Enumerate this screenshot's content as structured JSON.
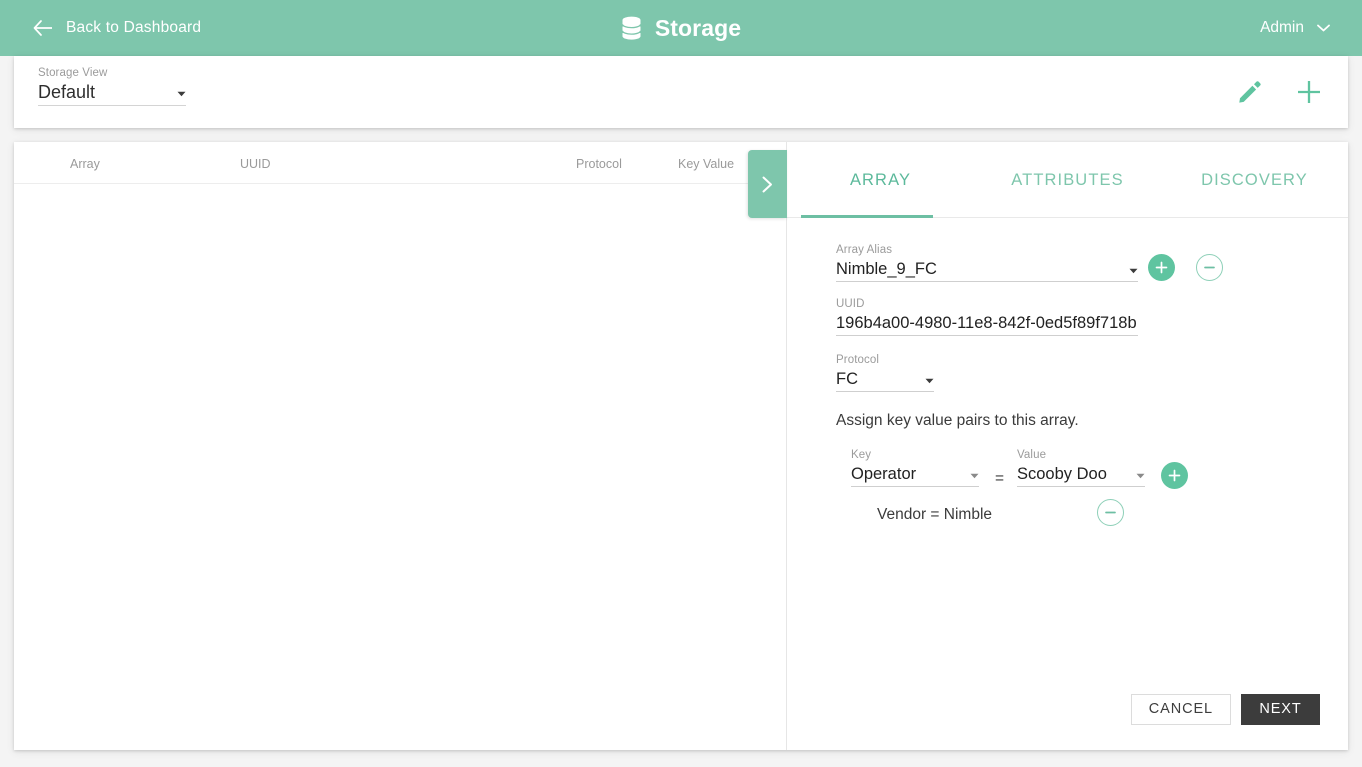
{
  "header": {
    "back_label": "Back to Dashboard",
    "back_icon": "arrow-left-icon",
    "title": "Storage",
    "title_icon": "database-icon",
    "user_label": "Admin",
    "user_caret_icon": "chevron-down-icon",
    "background_color": "#7ec6ac"
  },
  "toolbar": {
    "storage_view_label": "Storage View",
    "storage_view_value": "Default",
    "edit_icon": "pencil-icon",
    "add_icon": "plus-icon",
    "accent_color": "#5fc4a0"
  },
  "table": {
    "columns": [
      "Array",
      "UUID",
      "Protocol",
      "Key Value"
    ],
    "rows": []
  },
  "collapse_tab": {
    "icon": "chevron-right-icon"
  },
  "detail": {
    "tabs": [
      {
        "label": "ARRAY",
        "active": true
      },
      {
        "label": "ATTRIBUTES",
        "active": false
      },
      {
        "label": "DISCOVERY",
        "active": false
      }
    ],
    "fields": {
      "array_alias_label": "Array Alias",
      "array_alias_value": "Nimble_9_FC",
      "uuid_label": "UUID",
      "uuid_value": "196b4a00-4980-11e8-842f-0ed5f89f718b",
      "protocol_label": "Protocol",
      "protocol_value": "FC"
    },
    "alias_add_icon": "plus-circle-icon",
    "alias_remove_icon": "minus-circle-icon",
    "assign_note": "Assign key value pairs to this array.",
    "key_value_editor": {
      "key_label": "Key",
      "key_value": "Operator",
      "equals": "=",
      "value_label": "Value",
      "value_value": "Scooby Doo",
      "add_icon": "plus-circle-icon"
    },
    "existing_pairs": [
      {
        "text": "Vendor = Nimble",
        "remove_icon": "minus-circle-icon"
      }
    ],
    "footer": {
      "cancel_label": "CANCEL",
      "next_label": "NEXT"
    }
  }
}
